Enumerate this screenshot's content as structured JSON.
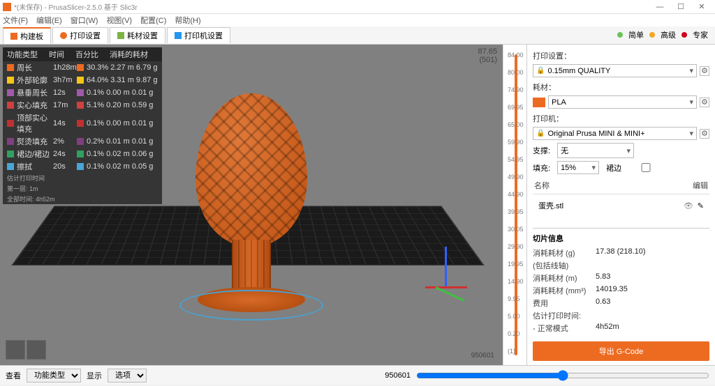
{
  "window": {
    "title": "*(未保存) - PrusaSlicer-2.5.0 基于 Slic3r"
  },
  "menu": [
    "文件(F)",
    "编辑(E)",
    "窗口(W)",
    "视图(V)",
    "配置(C)",
    "帮助(H)"
  ],
  "tabs": [
    {
      "label": "构建板"
    },
    {
      "label": "打印设置"
    },
    {
      "label": "耗材设置"
    },
    {
      "label": "打印机设置"
    }
  ],
  "status": [
    {
      "color": "#6ac259",
      "label": "简单"
    },
    {
      "color": "#f5a623",
      "label": "高级"
    },
    {
      "color": "#d0021b",
      "label": "专家"
    }
  ],
  "info": {
    "headers": [
      "功能类型",
      "时间",
      "百分比",
      "消耗的耗材"
    ],
    "rows": [
      {
        "c": "#ed6b21",
        "n": "周长",
        "t": "1h28m",
        "p": "30.3% 2.27 m  6.79 g"
      },
      {
        "c": "#f5c518",
        "n": "外部轮廓",
        "t": "3h7m",
        "p": "64.0% 3.31 m  9.87 g"
      },
      {
        "c": "#a05aaa",
        "n": "悬垂周长",
        "t": "12s",
        "p": "0.1% 0.00 m  0.01 g"
      },
      {
        "c": "#d04040",
        "n": "实心填充",
        "t": "17m",
        "p": "5.1% 0.20 m  0.59 g"
      },
      {
        "c": "#c03030",
        "n": "顶部实心填充",
        "t": "14s",
        "p": "0.1% 0.00 m  0.01 g"
      },
      {
        "c": "#804080",
        "n": "熨烫填充",
        "t": "2%",
        "p": "0.2% 0.01 m  0.01 g"
      },
      {
        "c": "#30a060",
        "n": "裙边/裙边",
        "t": "24s",
        "p": "0.1% 0.02 m  0.06 g"
      },
      {
        "c": "#4aa5d8",
        "n": "擦拭",
        "t": "20s",
        "p": "0.1% 0.02 m  0.05 g"
      }
    ],
    "footer1": "估计打印时间",
    "footer2": "第一层: 1m",
    "footer3": "全部时间: 4h52m"
  },
  "viewport": {
    "topval": "87.65",
    "topsub": "(501)",
    "bottomcoord": "950601"
  },
  "slider_ticks": [
    "84.00",
    "80.00",
    "74.90",
    "69.95",
    "65.00",
    "59.90",
    "54.95",
    "49.90",
    "44.90",
    "39.95",
    "30.05",
    "29.90",
    "19.95",
    "14.90",
    "9.95",
    "5.00",
    "0.20",
    "(1)"
  ],
  "side": {
    "print_lbl": "打印设置：",
    "print_val": "0.15mm QUALITY",
    "fil_lbl": "耗材：",
    "fil_val": "PLA",
    "printer_lbl": "打印机：",
    "printer_val": "Original Prusa MINI & MINI+",
    "support_lbl": "支撑:",
    "support_val": "无",
    "infill_lbl": "填充:",
    "infill_val": "15%",
    "brim_lbl": "裙边",
    "list_h1": "名称",
    "list_h2": "编辑",
    "item": "蛋壳.stl",
    "info_title": "切片信息",
    "irows": [
      {
        "k": "消耗耗材 (g)",
        "v": "17.38 (218.10)"
      },
      {
        "k": "(包括线轴)",
        "v": ""
      },
      {
        "k": "消耗耗材 (m)",
        "v": "5.83"
      },
      {
        "k": "消耗耗材 (mm³)",
        "v": "14019.35"
      },
      {
        "k": "费用",
        "v": "0.63"
      },
      {
        "k": "估计打印时间:",
        "v": ""
      },
      {
        "k": "- 正常模式",
        "v": "4h52m"
      }
    ],
    "export": "导出 G-Code"
  },
  "bottom": {
    "view_lbl": "查看",
    "view_val": "功能类型",
    "show_lbl": "显示",
    "show_val": "选项",
    "coord": "950601"
  }
}
